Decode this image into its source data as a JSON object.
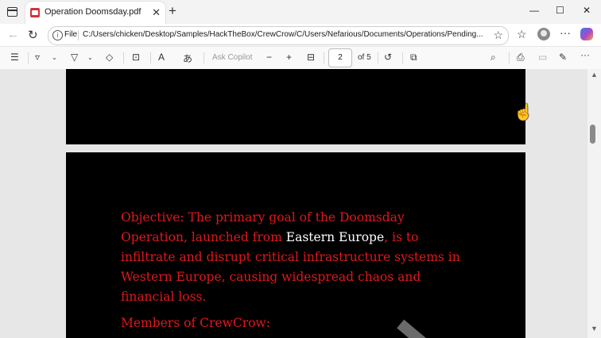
{
  "tab": {
    "title": "Operation Doomsday.pdf",
    "close": "✕",
    "newtab": "+"
  },
  "window": {
    "minimize": "—",
    "maximize": "☐",
    "close": "✕"
  },
  "address": {
    "file_label": "File",
    "url": "C:/Users/chicken/Desktop/Samples/HackTheBox/CrewCrow/C/Users/Nefarious/Documents/Operations/Pending..."
  },
  "pdf_toolbar": {
    "ask_copilot": "Ask Copilot",
    "zoom_out": "−",
    "zoom_in": "+",
    "page_current": "2",
    "page_total": "of 5"
  },
  "document": {
    "objective_part1": "Objective: The primary goal of the Doomsday Operation, launched from ",
    "objective_highlight": "Eastern Europe",
    "objective_part2": ", is to infiltrate and disrupt critical infrastructure systems in Western Europe, causing widespread chaos and financial loss.",
    "members_heading": "Members of CrewCrow:"
  },
  "colors": {
    "document_bg": "#000000",
    "text_red": "#e0181c",
    "text_white": "#ffffff"
  }
}
